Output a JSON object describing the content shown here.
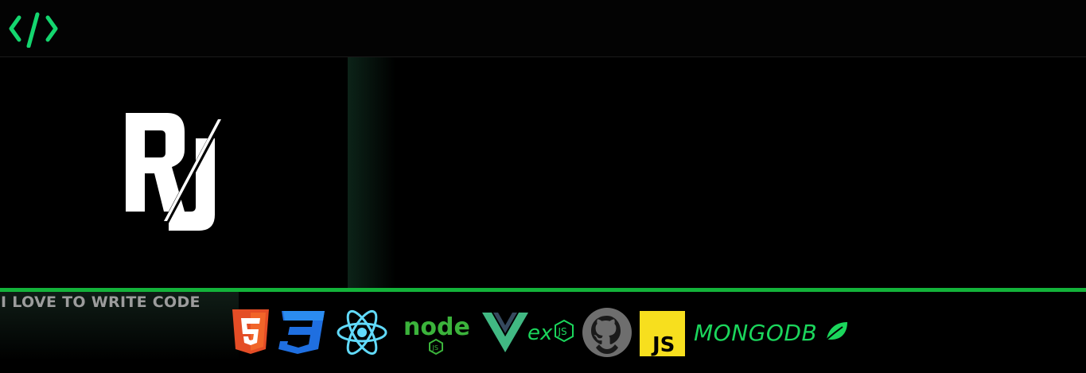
{
  "header": {
    "logo_icon": "code-brackets-icon",
    "accent": "#14d66f"
  },
  "hero": {
    "logo_text": "RJ",
    "logo_color": "#ffffff"
  },
  "footer": {
    "tagline": "I LOVE TO WRITE CODE",
    "tech_icons": [
      {
        "name": "html5-icon",
        "label": "5"
      },
      {
        "name": "css3-icon",
        "label": "3"
      },
      {
        "name": "react-icon"
      },
      {
        "name": "nodejs-icon",
        "label": "node",
        "sublabel": "JS"
      },
      {
        "name": "vuejs-icon"
      },
      {
        "name": "expressjs-icon",
        "label": "ex",
        "sublabel": "JS"
      },
      {
        "name": "github-icon"
      },
      {
        "name": "javascript-icon",
        "label": "JS"
      }
    ],
    "mongodb_label": "MONGODB",
    "mongodb_icon": "leaf-icon"
  },
  "colors": {
    "divider": "#13b33a",
    "html": "#e44d26",
    "css": "#1572b6",
    "react": "#61dafb",
    "node": "#3bb33b",
    "vue": "#41b883",
    "express": "#1bd65c",
    "github": "#6e6e6e",
    "js": "#f7df1e",
    "mongo": "#1bd65c"
  }
}
